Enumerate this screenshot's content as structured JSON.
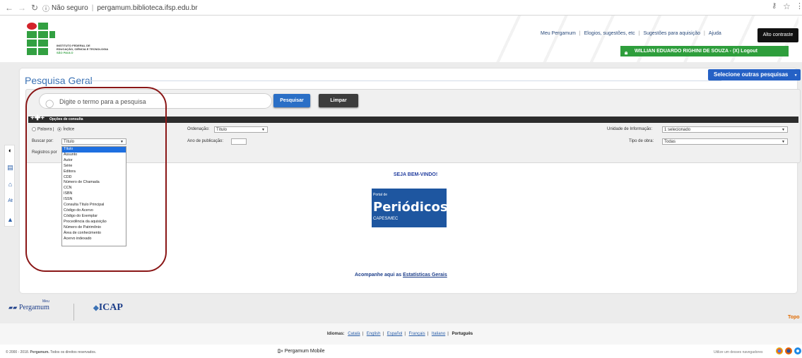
{
  "browser": {
    "security": "Não seguro",
    "url": "pergamum.biblioteca.ifsp.edu.br"
  },
  "header": {
    "institute_lines": [
      "INSTITUTO FEDERAL DE",
      "EDUCAÇÃO, CIÊNCIA E TECNOLOGIA",
      "SÃO PAULO"
    ],
    "links": [
      "Meu Pergamum",
      "Elogios, sugestões, etc",
      "Sugestões para aquisição",
      "Ajuda"
    ],
    "contrast_button": "Alto contraste",
    "user_bar": "WILLIAN EDUARDO RIGHINI DE SOUZA - (X) Logout"
  },
  "main": {
    "title": "Pesquisa Geral",
    "other_searches": "Selecione outras pesquisas",
    "search_placeholder": "Digite o termo para a pesquisa",
    "search_button": "Pesquisar",
    "clear_button": "Limpar",
    "options_label": "Opções de consulta",
    "radio_word": "Palavra |",
    "radio_index": "Índice",
    "search_by_label": "Buscar por:",
    "search_by_value": "Título",
    "registros_label": "Registros por",
    "ordering_label": "Ordenação:",
    "ordering_value": "Título",
    "pub_year_label": "Ano de publicação:",
    "unit_label": "Unidade de Informação:",
    "unit_value": "1 selecionado",
    "work_type_label": "Tipo de obra:",
    "work_type_value": "Todas",
    "dropdown_options": [
      "Título",
      "Assunto",
      "Autor",
      "Série",
      "Editora",
      "CDD",
      "Número de Chamada",
      "CCN",
      "ISBN",
      "ISSN",
      "Consulta Título Principal",
      "Código do Acervo",
      "Código do Exemplar",
      "Procedência da aquisição",
      "Número de Patrimônio",
      "Área de conhecimento",
      "Acervo indexado"
    ],
    "welcome": "SEJA BEM-VINDO!",
    "periodicos_top": "Portal de",
    "periodicos_main": "Periódicos",
    "periodicos_sub": "CAPES/MEC",
    "stats_prefix": "Acompanhe aqui as",
    "stats_link": "Estatísticas Gerais"
  },
  "toolbar_icons": [
    "contrast-icon",
    "library-icon",
    "home-icon",
    "font-size-icon",
    "up-arrow-icon"
  ],
  "footer": {
    "pergamum_meu": "Meu",
    "pergamum": "Pergamum",
    "icap": "ICAP",
    "topo": "Topo",
    "languages_label": "Idiomas:",
    "languages": [
      "Català",
      "English",
      "Español",
      "Français",
      "Italiano"
    ],
    "current_language": "Português",
    "copyright_prefix": "© 2000 - 2018.",
    "copyright_brand": "Pergamum.",
    "copyright_suffix": "Todos os direitos reservados.",
    "mobile": "» Pergamum Mobile",
    "browsers_note": "Utilize um desses navegadores"
  },
  "colors": {
    "title_blue": "#3b72b5",
    "user_bar_green": "#2e9e3c",
    "annotation_red": "#8a1616"
  }
}
